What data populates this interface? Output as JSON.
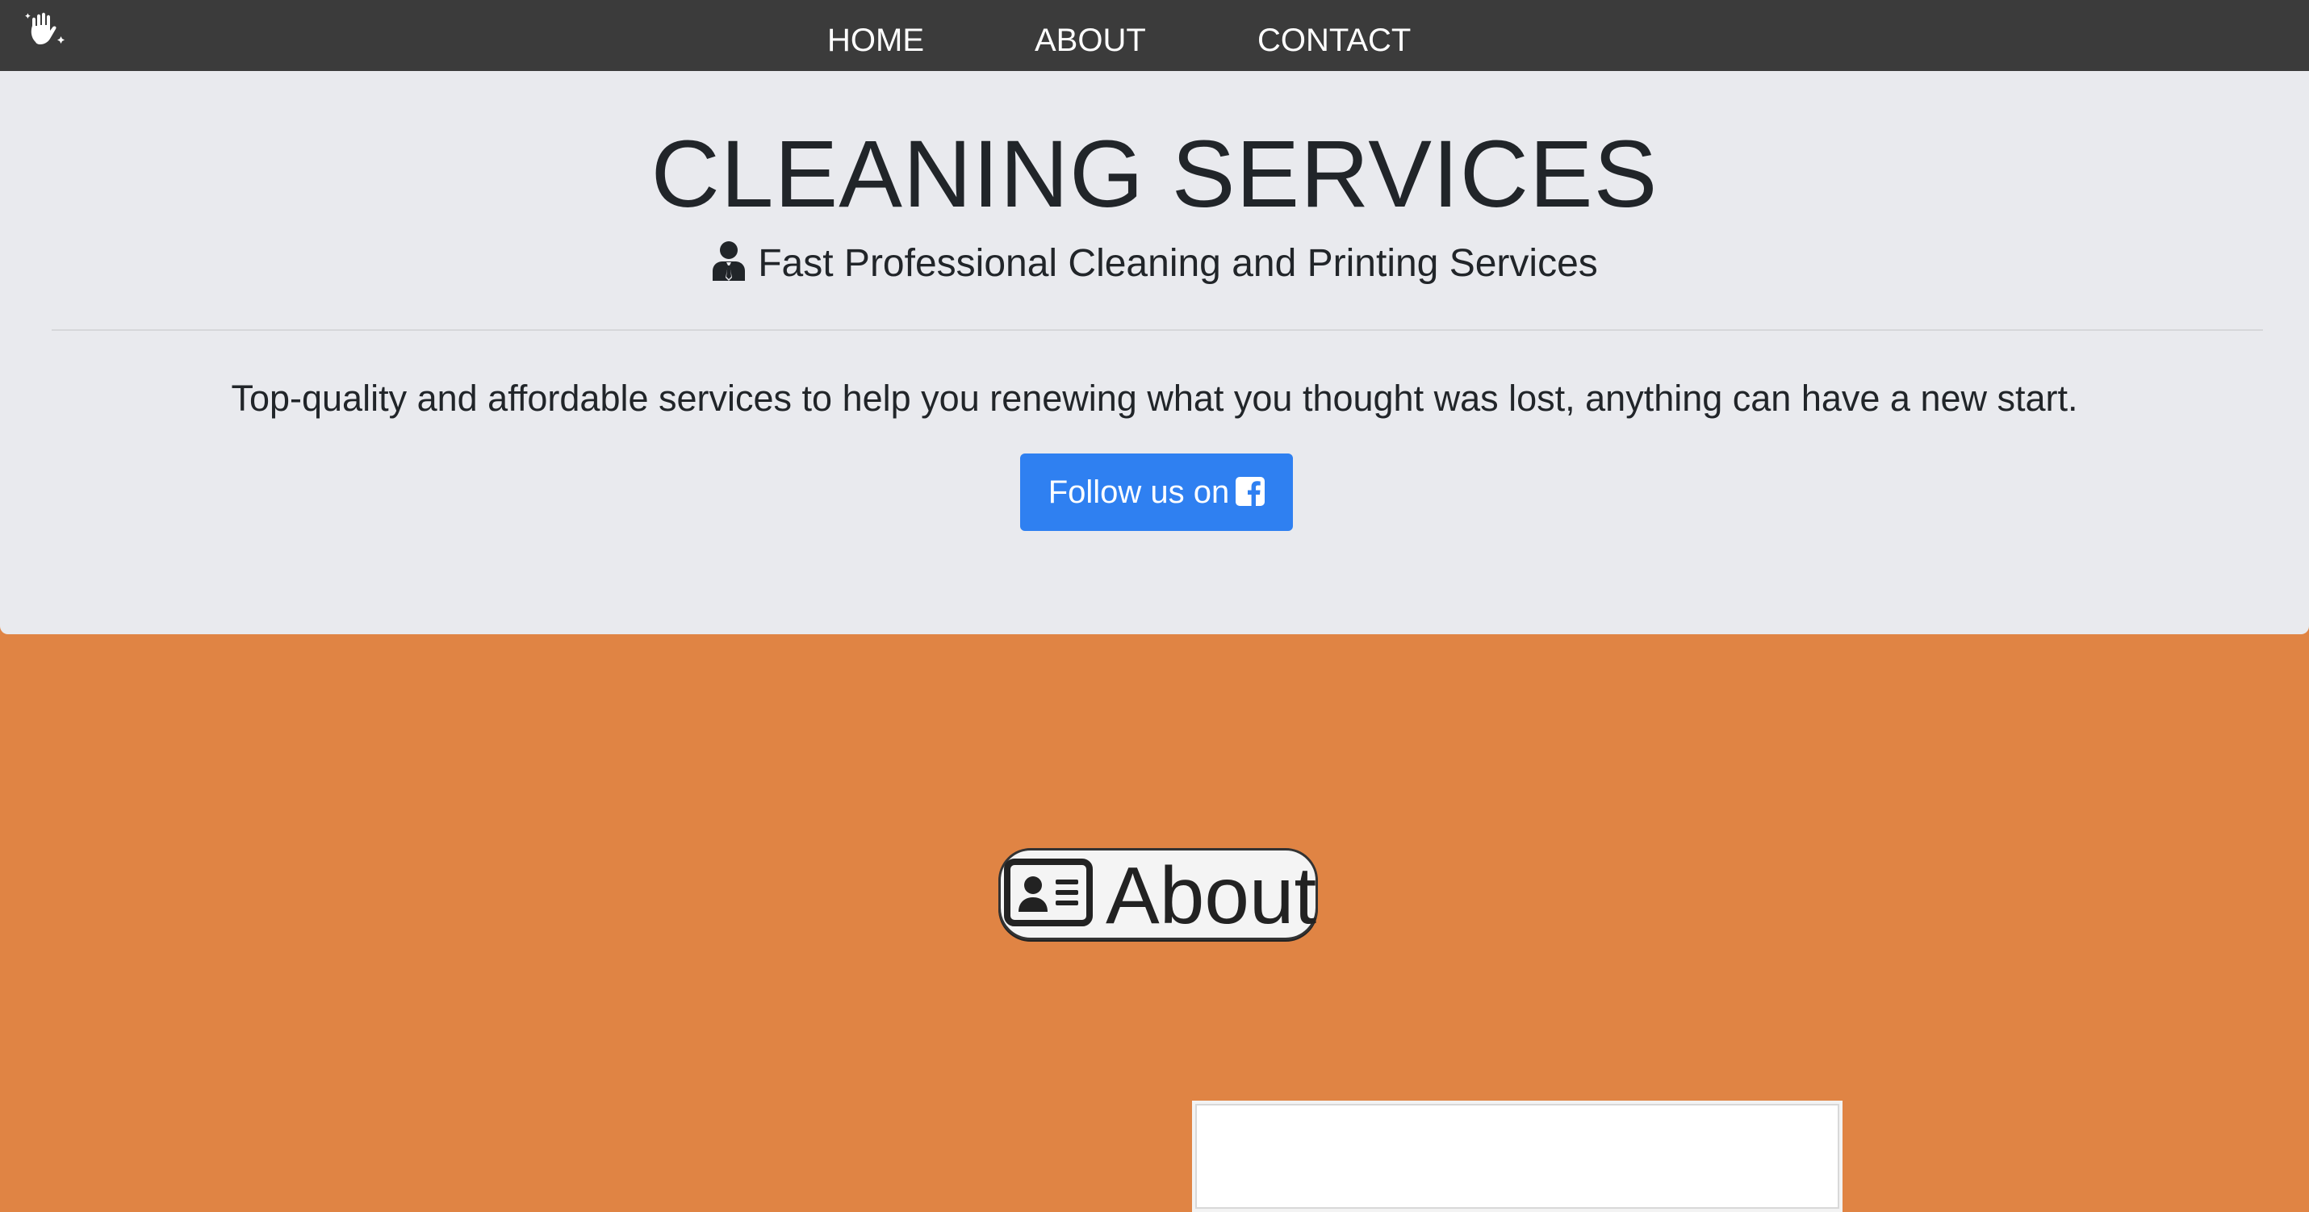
{
  "nav": {
    "logo_icon": "hand-sparkle-icon",
    "home": "HOME",
    "about": "ABOUT",
    "contact": "CONTACT"
  },
  "hero": {
    "title": "CLEANING SERVICES",
    "subtitle": "Fast Professional Cleaning and Printing Services",
    "subtitle_icon": "user-tie-icon",
    "lead": "Top-quality and affordable services to help you renewing what you thought was lost, anything can have a new start.",
    "follow_button": "Follow us on",
    "follow_icon": "facebook-square-icon"
  },
  "about": {
    "heading": "About",
    "heading_icon": "id-card-icon"
  },
  "colors": {
    "navbar": "#3b3b3b",
    "hero_bg": "#e9eaee",
    "button": "#2f80f1",
    "about_bg": "#e08444"
  }
}
